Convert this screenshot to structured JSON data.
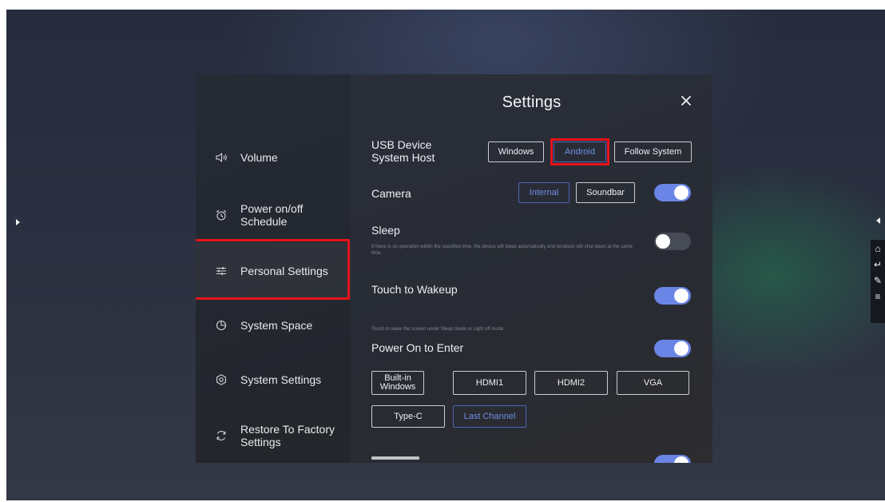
{
  "dialog": {
    "title": "Settings"
  },
  "sidebar": {
    "items": [
      {
        "label": "Volume"
      },
      {
        "label": "Power on/off Schedule"
      },
      {
        "label": "Personal Settings"
      },
      {
        "label": "System Space"
      },
      {
        "label": "System Settings"
      },
      {
        "label": "Restore To Factory Settings"
      }
    ]
  },
  "usb": {
    "label": "USB Device System Host",
    "options": [
      "Windows",
      "Android",
      "Follow System"
    ],
    "selected": "Android"
  },
  "camera": {
    "label": "Camera",
    "options": [
      "Internal",
      "Soundbar"
    ],
    "selected": "Internal",
    "enabled": true
  },
  "sleep": {
    "label": "Sleep",
    "description": "If there is no operation within the specified time, the device will sleep automatically and windows will shut down at the same time.",
    "enabled": false
  },
  "touch_wakeup": {
    "label": "Touch to Wakeup",
    "description": "Touch to wake the screen under Sleep mode or Light off mode",
    "enabled": true
  },
  "power_on": {
    "label": "Power On to Enter",
    "enabled": true,
    "options": [
      "Built-in Windows",
      "HDMI1",
      "HDMI2",
      "VGA",
      "Type-C",
      "Last Channel"
    ],
    "selected": "Last Channel"
  },
  "colors": {
    "accent": "#6b85e6",
    "highlight": "#e8121a",
    "toggle_off": "#474b55"
  },
  "icons": {
    "edge_left": "chevron-right-icon",
    "edge_right": "chevron-left-icon",
    "toolbar": [
      "home-icon",
      "back-icon",
      "annotate-icon",
      "menu-icon"
    ]
  }
}
